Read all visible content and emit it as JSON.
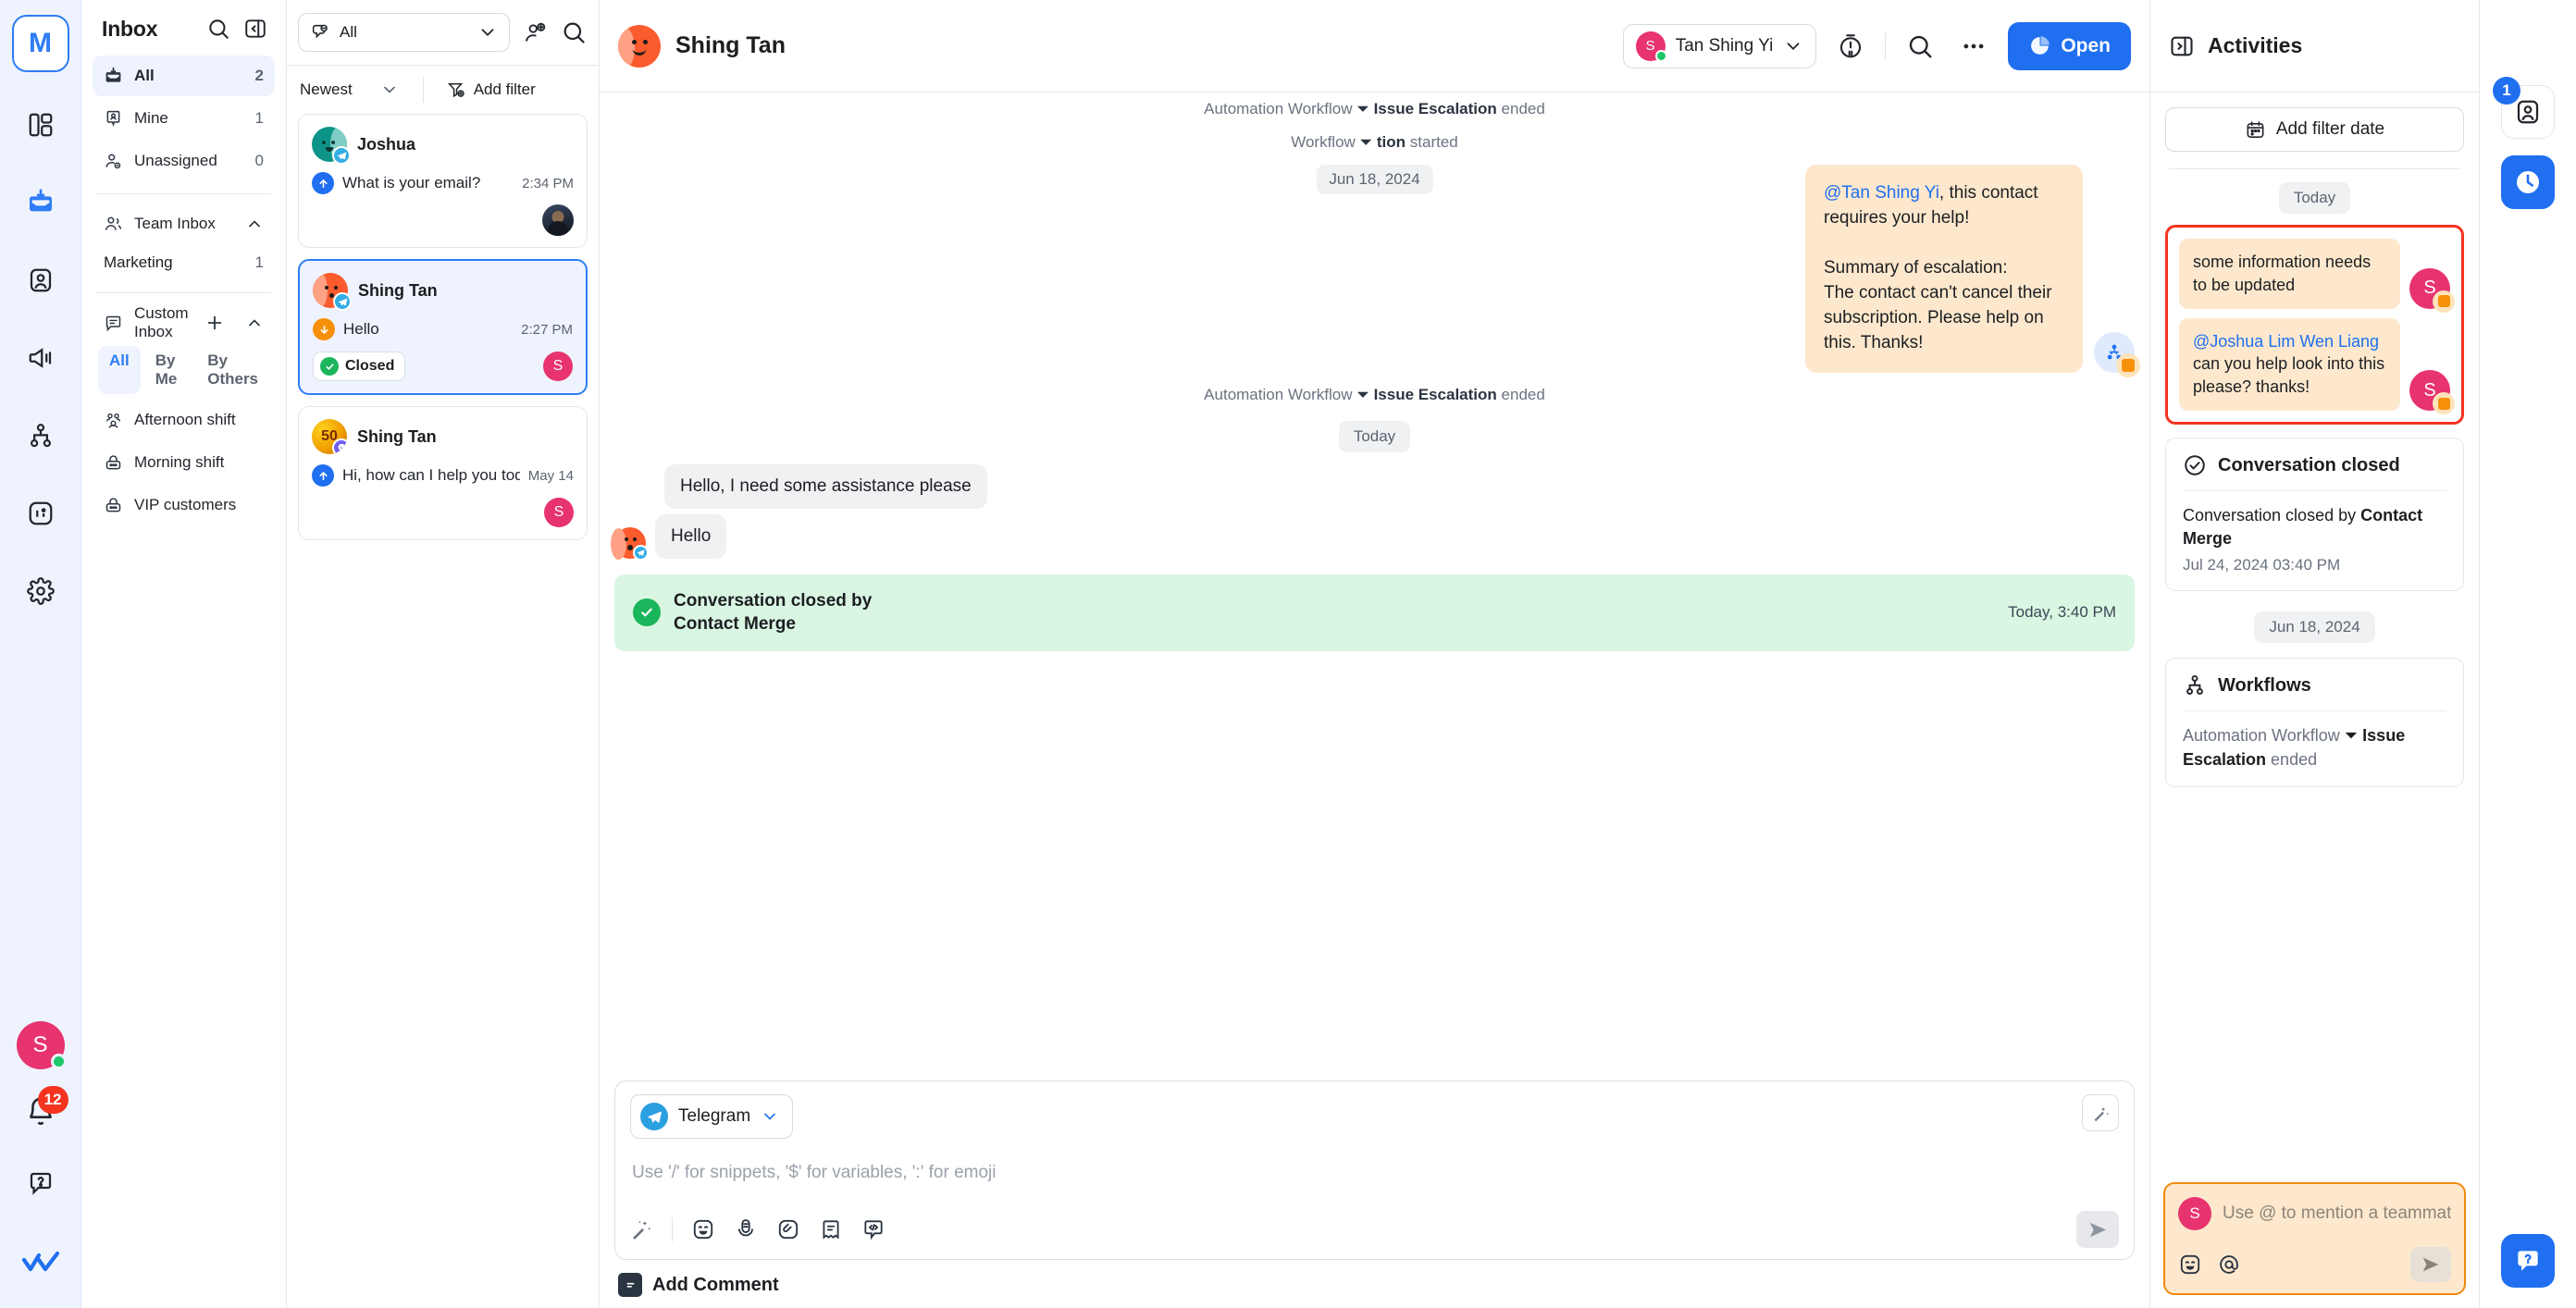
{
  "rail": {
    "logo_label": "M",
    "avatar_initial": "S",
    "notification_count": "12",
    "icons": [
      "dashboard-icon",
      "inbox-icon",
      "contacts-icon",
      "broadcast-icon",
      "workflows-icon",
      "reports-icon",
      "settings-icon"
    ]
  },
  "inbox_nav": {
    "title": "Inbox",
    "items": [
      {
        "label": "All",
        "count": "2"
      },
      {
        "label": "Mine",
        "count": "1"
      },
      {
        "label": "Unassigned",
        "count": "0"
      }
    ],
    "team_inbox": {
      "label": "Team Inbox",
      "children": [
        {
          "label": "Marketing",
          "count": "1"
        }
      ]
    },
    "custom_inbox": {
      "label": "Custom Inbox",
      "segments": [
        "All",
        "By Me",
        "By Others"
      ],
      "selected_segment": "All",
      "children": [
        "Afternoon shift",
        "Morning shift",
        "VIP customers"
      ]
    }
  },
  "conv_list": {
    "filter_label": "All",
    "sort_label": "Newest",
    "add_filter_label": "Add filter",
    "items": [
      {
        "name": "Joshua",
        "channel": "telegram",
        "preview": "What is your email?",
        "time": "2:34 PM",
        "direction": "outgoing",
        "status": "",
        "assignee_initial": "",
        "active": false
      },
      {
        "name": "Shing Tan",
        "channel": "telegram",
        "preview": "Hello",
        "time": "2:27 PM",
        "direction": "incoming",
        "status": "Closed",
        "assignee_initial": "S",
        "active": true
      },
      {
        "name": "Shing Tan",
        "channel": "viber",
        "preview": "Hi, how can I help you today?",
        "time": "May 14",
        "direction": "outgoing",
        "status": "",
        "assignee_initial": "S",
        "active": false
      }
    ]
  },
  "chat": {
    "contact_name": "Shing Tan",
    "assignee_name": "Tan Shing Yi",
    "assignee_initial": "S",
    "open_button": "Open",
    "floating_date": "Jun 18, 2024",
    "system_top": {
      "prefix": "Automation Workflow",
      "name": "Issue Escalation",
      "suffix": "ended"
    },
    "system_second": {
      "prefix": "Workflow",
      "name": "tion",
      "suffix": "started"
    },
    "note_bubble": {
      "mention": "@Tan Shing Yi",
      "line1": ", this contact requires your help!",
      "line2": "Summary of escalation:",
      "line3": "The contact can't cancel their subscription. Please help on this. Thanks!"
    },
    "system_third": {
      "prefix": "Automation Workflow",
      "name": "Issue Escalation",
      "suffix": "ended"
    },
    "today_chip": "Today",
    "messages": [
      {
        "text": "Hello, I need some assistance please",
        "avatar": false
      },
      {
        "text": "Hello",
        "avatar": true
      }
    ],
    "closed_banner": {
      "line1": "Conversation closed by",
      "line2": "Contact Merge",
      "time": "Today, 3:40 PM"
    },
    "composer": {
      "channel": "Telegram",
      "placeholder": "Use '/' for snippets, '$' for variables, ':' for emoji",
      "add_comment_label": "Add Comment",
      "tools": [
        "magic-wand-icon",
        "emoji-icon",
        "voice-icon",
        "attachment-icon",
        "snippet-icon",
        "variable-icon"
      ]
    }
  },
  "activities": {
    "title": "Activities",
    "add_filter_date": "Add filter date",
    "today_chip": "Today",
    "highlighted_notes": [
      {
        "text": "some information needs to be updated",
        "mention": "",
        "avatar_initial": "S"
      },
      {
        "mention": "@Joshua Lim Wen Liang",
        "text": " can you help look into this please? thanks!",
        "avatar_initial": "S"
      }
    ],
    "cards": [
      {
        "title": "Conversation closed",
        "icon": "check-circle-icon",
        "body_prefix": "Conversation closed by ",
        "body_bold": "Contact Merge",
        "sub": "Jul 24, 2024 03:40 PM"
      }
    ],
    "date_chip": "Jun 18, 2024",
    "workflow_card": {
      "title": "Workflows",
      "icon": "workflows-icon",
      "body_prefix": "Automation Workflow ",
      "body_bold": "Issue Escalation",
      "body_suffix": " ended"
    },
    "comment_box": {
      "avatar_initial": "S",
      "placeholder": "Use @ to mention a teammate. Com..."
    }
  },
  "right_rail": {
    "contact_badge": "1",
    "buttons": [
      "contact-icon",
      "activity-clock-icon",
      "help-icon"
    ]
  },
  "colors": {
    "accent": "#1f6ff0",
    "pink": "#e7336e",
    "orange": "#f79009",
    "green": "#1bb55c",
    "highlight_red": "#f5341f",
    "note_bg": "#fde8cd"
  }
}
